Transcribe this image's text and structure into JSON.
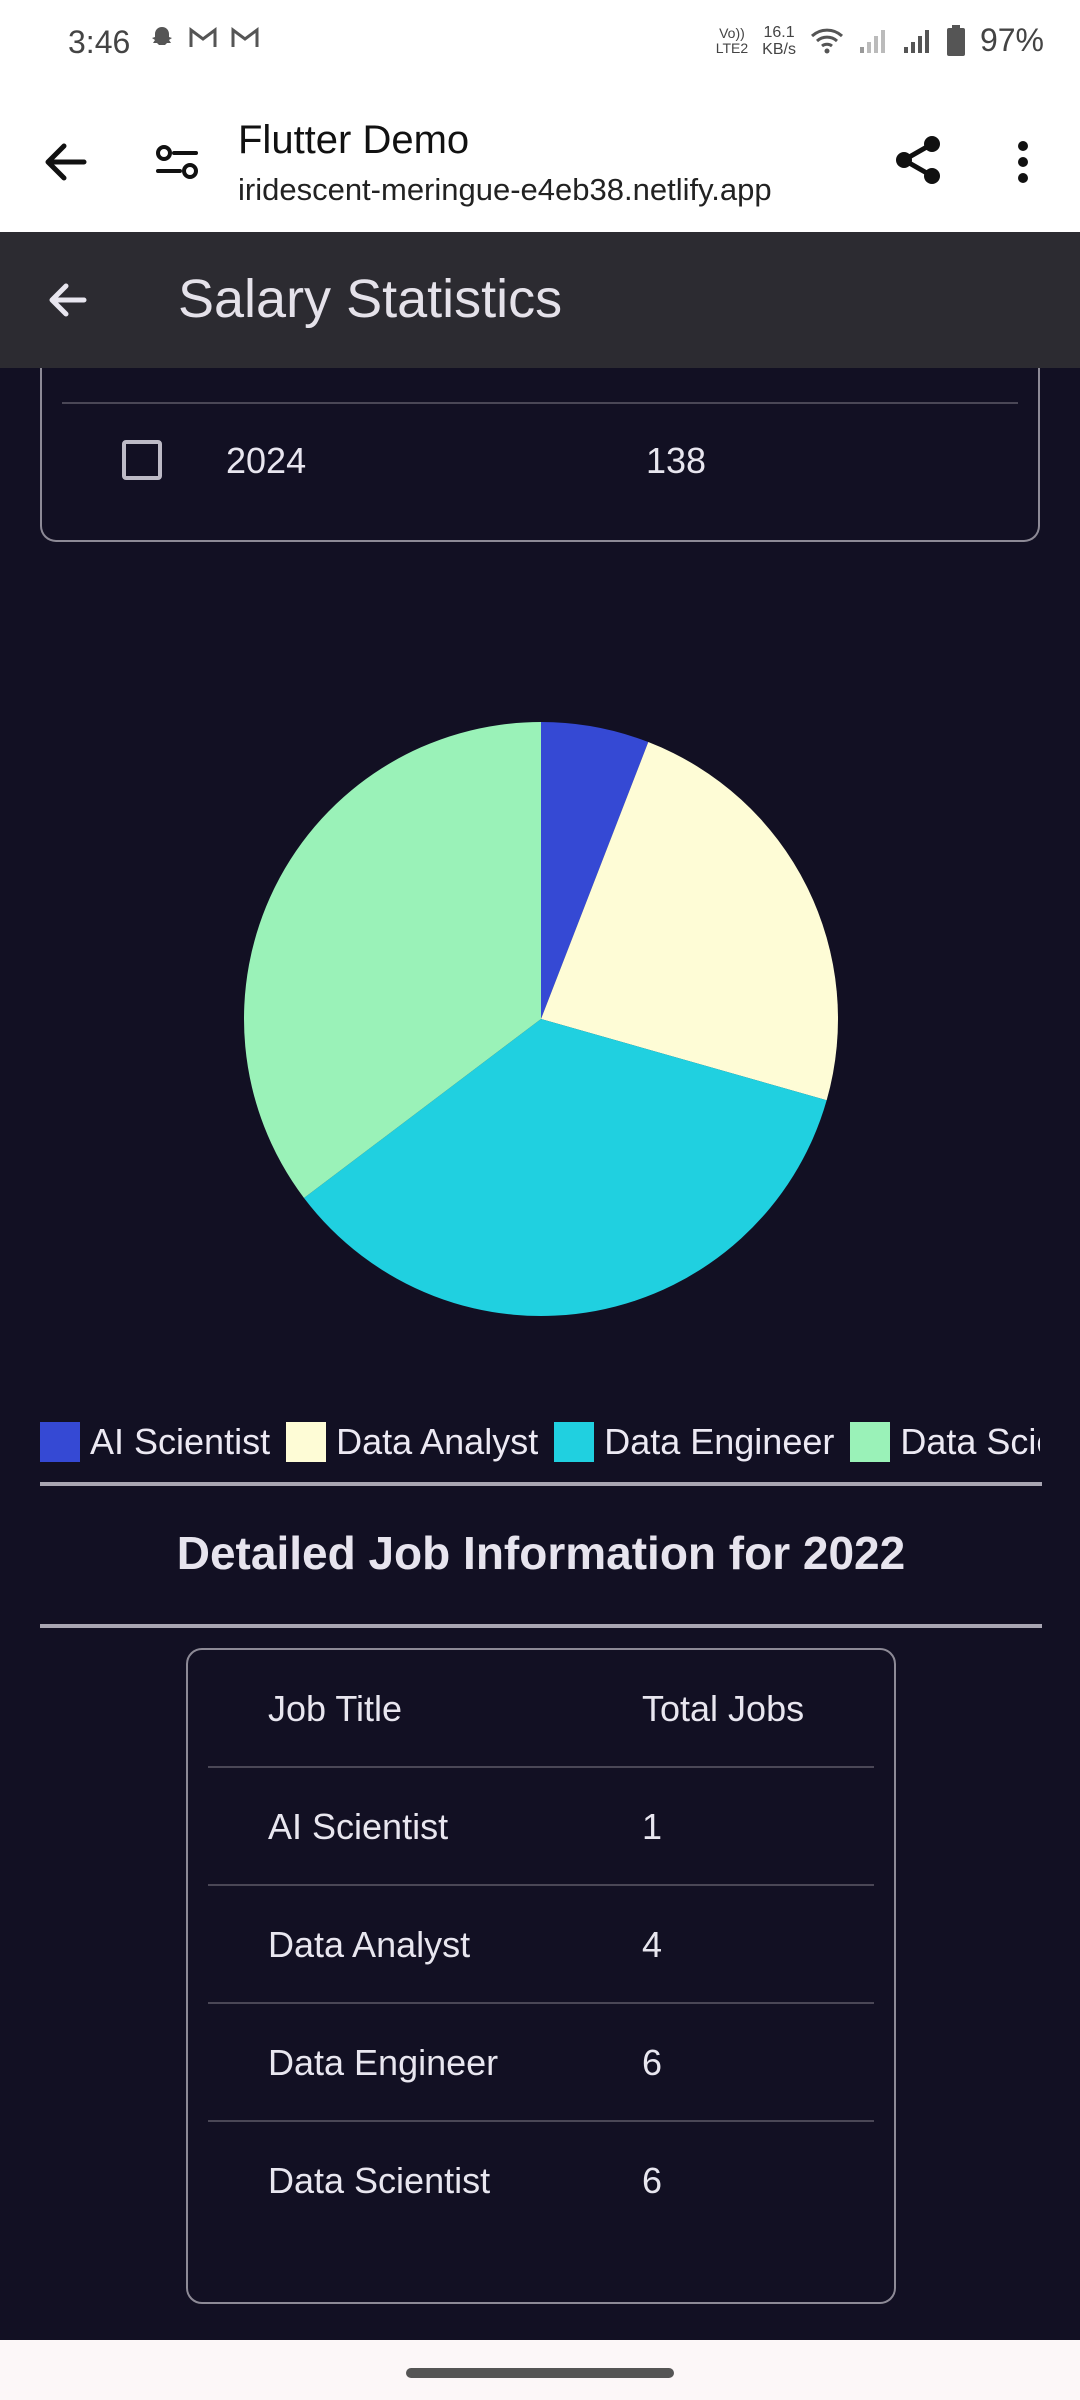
{
  "status_bar": {
    "time": "3:46",
    "net_speed_value": "16.1",
    "net_speed_unit": "KB/s",
    "volte_top": "Vo))",
    "volte_bottom": "LTE2",
    "battery": "97%"
  },
  "browser": {
    "title": "Flutter Demo",
    "url": "iridescent-meringue-e4eb38.netlify.app"
  },
  "app_bar": {
    "title": "Salary Statistics"
  },
  "year_table": {
    "rows": [
      {
        "year": "2024",
        "count": "138"
      }
    ]
  },
  "chart_data": {
    "type": "pie",
    "title": "",
    "slices": [
      {
        "label": "AI Scientist",
        "value": 1,
        "color": "#3549d4"
      },
      {
        "label": "Data Analyst",
        "value": 4,
        "color": "#fefcd6"
      },
      {
        "label": "Data Engineer",
        "value": 6,
        "color": "#20d0e0"
      },
      {
        "label": "Data Scientist",
        "value": 6,
        "color": "#9af2b8"
      }
    ]
  },
  "legend": {
    "items": [
      {
        "label": "AI Scientist",
        "color": "#3549d4"
      },
      {
        "label": "Data Analyst",
        "color": "#fefcd6"
      },
      {
        "label": "Data Engineer",
        "color": "#20d0e0"
      },
      {
        "label": "Data Scientist",
        "color": "#9af2b8"
      }
    ]
  },
  "section": {
    "title": "Detailed Job Information for 2022"
  },
  "jobs_table": {
    "headers": {
      "job_title": "Job Title",
      "total_jobs": "Total Jobs"
    },
    "rows": [
      {
        "title": "AI Scientist",
        "jobs": "1"
      },
      {
        "title": "Data Analyst",
        "jobs": "4"
      },
      {
        "title": "Data Engineer",
        "jobs": "6"
      },
      {
        "title": "Data Scientist",
        "jobs": "6"
      }
    ]
  },
  "colors": {
    "background": "#121023",
    "app_bar": "#2c2b31"
  },
  "icons": {
    "browser_back": "arrow-left-icon",
    "site_settings": "tune-icon",
    "share": "share-icon",
    "more": "more-vert-icon",
    "app_back": "arrow-left-icon",
    "checkbox": "checkbox-unchecked-icon"
  }
}
